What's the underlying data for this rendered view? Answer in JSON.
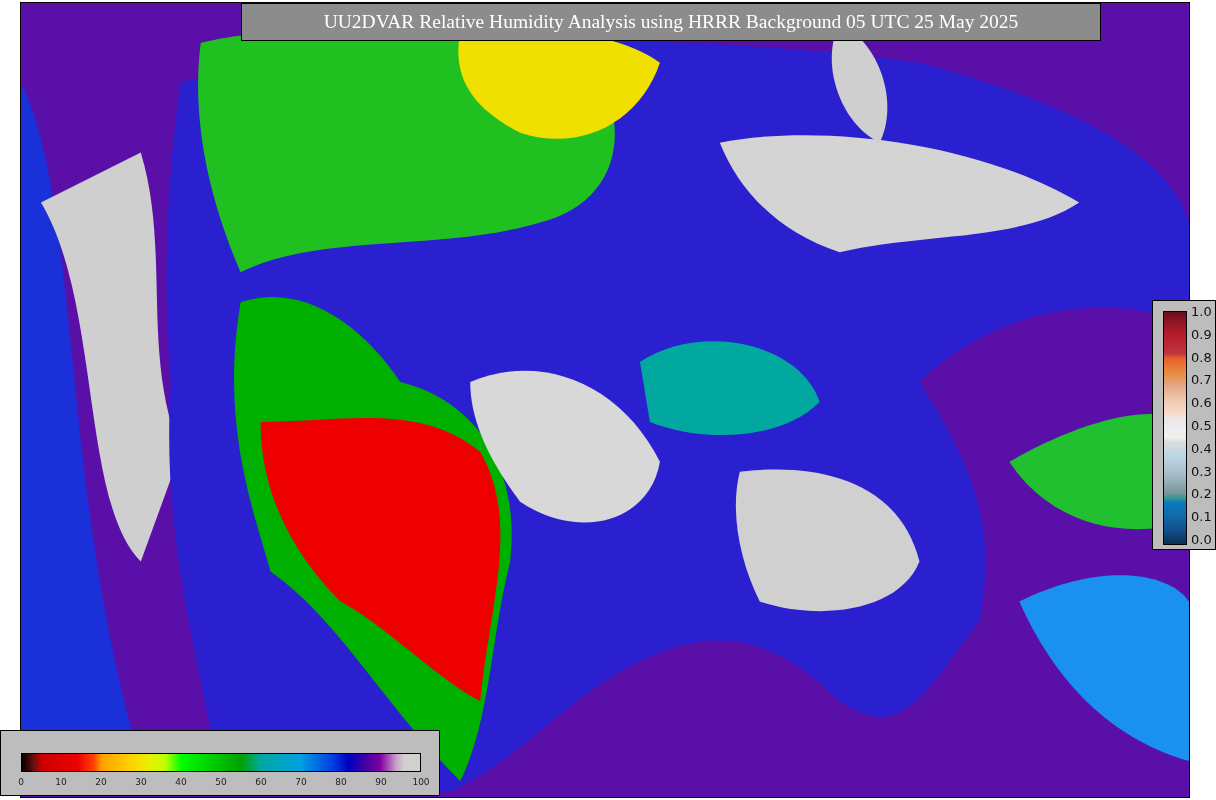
{
  "title": "UU2DVAR Relative Humidity Analysis using HRRR Background 05 UTC 25 May 2025",
  "humidity_legend": {
    "ticks": [
      "0",
      "10",
      "20",
      "30",
      "40",
      "50",
      "60",
      "70",
      "80",
      "90",
      "100"
    ]
  },
  "ratio_legend": {
    "ticks": [
      "1.0",
      "0.9",
      "0.8",
      "0.7",
      "0.6",
      "0.5",
      "0.4",
      "0.3",
      "0.2",
      "0.1",
      "0.0"
    ]
  }
}
